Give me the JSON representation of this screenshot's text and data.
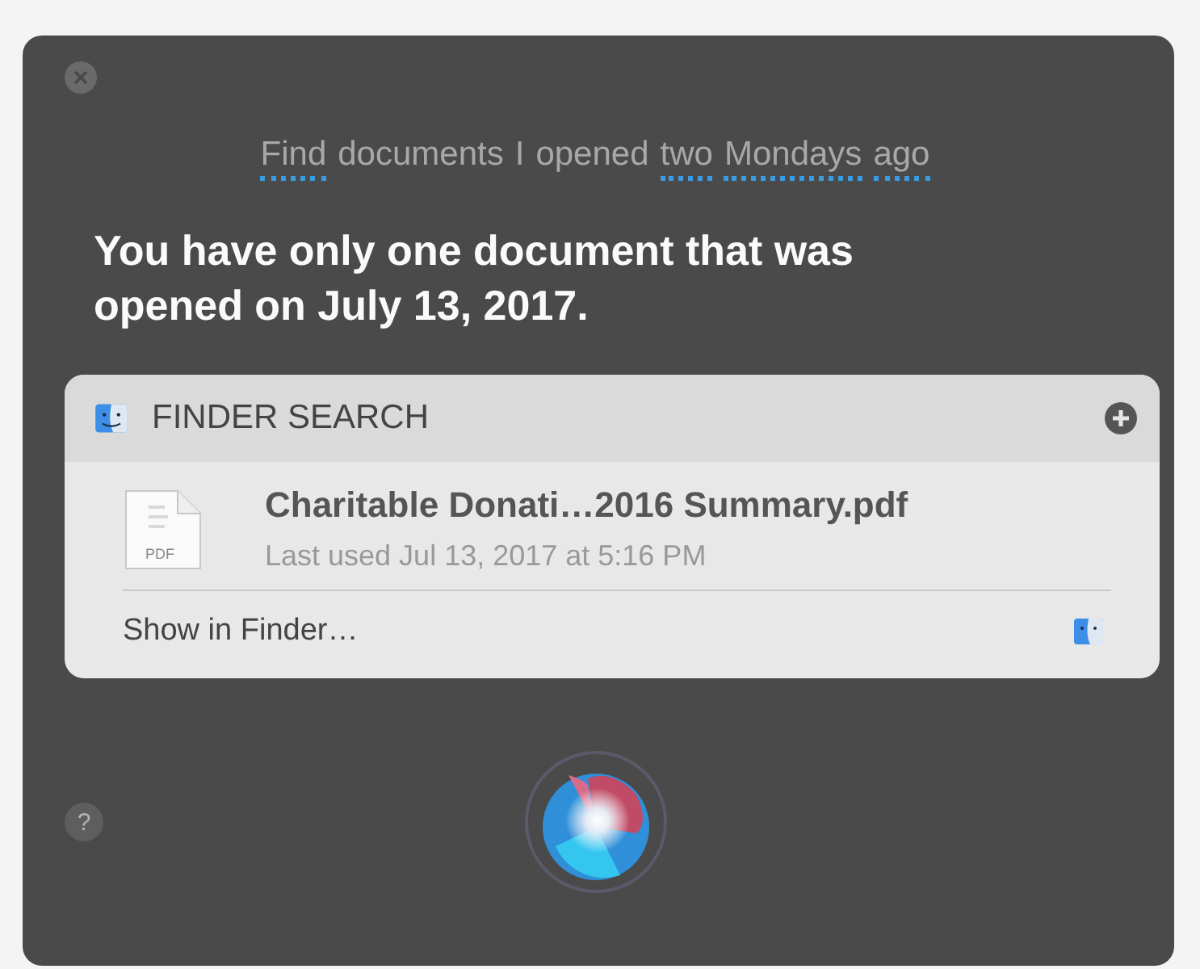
{
  "query": {
    "words": [
      {
        "text": "Find",
        "underlined": true
      },
      {
        "text": "documents",
        "underlined": false
      },
      {
        "text": "I",
        "underlined": false
      },
      {
        "text": "opened",
        "underlined": false
      },
      {
        "text": "two",
        "underlined": true
      },
      {
        "text": "Mondays",
        "underlined": true
      },
      {
        "text": "ago",
        "underlined": true
      }
    ]
  },
  "response": "You have only one document that was opened on July 13, 2017.",
  "card": {
    "title": "FINDER SEARCH",
    "result": {
      "name": "Charitable Donati…2016 Summary.pdf",
      "detail": "Last used Jul 13, 2017 at 5:16 PM",
      "file_type": "PDF"
    },
    "footer_action": "Show in Finder…"
  },
  "help": "?"
}
